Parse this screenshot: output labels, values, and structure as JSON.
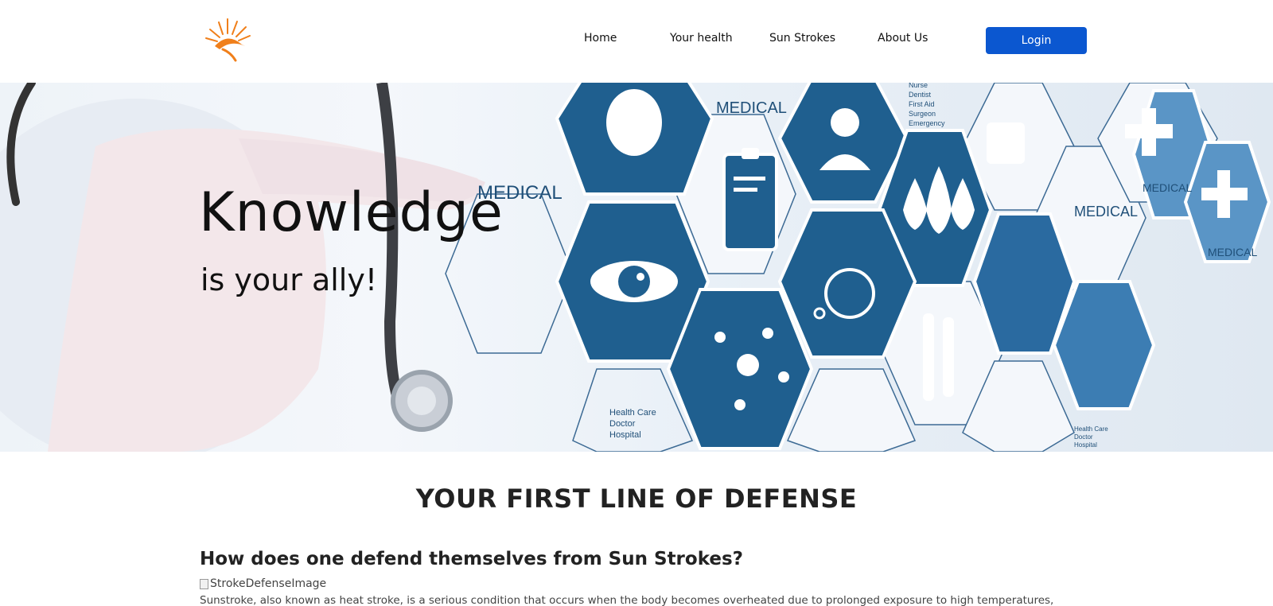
{
  "nav": {
    "items": [
      {
        "label": "Home"
      },
      {
        "label": "Your health"
      },
      {
        "label": "Sun Strokes"
      },
      {
        "label": "About Us"
      }
    ],
    "login_label": "Login"
  },
  "logo": {
    "icon": "sun-logo-icon",
    "color": "#f07f1a"
  },
  "hero": {
    "title": "Knowledge",
    "subtitle": "is your ally!",
    "image_labels": {
      "medical": "MEDICAL",
      "staff_list": [
        "Nurse",
        "Dentist",
        "First Aid",
        "Surgeon",
        "Emergency"
      ],
      "care_list": [
        "Health Care",
        "Doctor",
        "Hospital"
      ],
      "care_list_small": [
        "Health Care",
        "Doctor",
        "Hospital"
      ]
    },
    "colors": {
      "hex_dark": "#1f5f8f",
      "hex_mid": "#3c7db3",
      "hex_light": "#5a95c6"
    }
  },
  "content": {
    "section_title": "YOUR FIRST LINE OF DEFENSE",
    "question": "How does one defend themselves from Sun Strokes?",
    "image_alt": "StrokeDefenseImage",
    "paragraph": "Sunstroke, also known as heat stroke, is a serious condition that occurs when the body becomes overheated due to prolonged exposure to high temperatures,"
  },
  "colors": {
    "primary": "#0b57d0",
    "accent": "#f07f1a"
  }
}
